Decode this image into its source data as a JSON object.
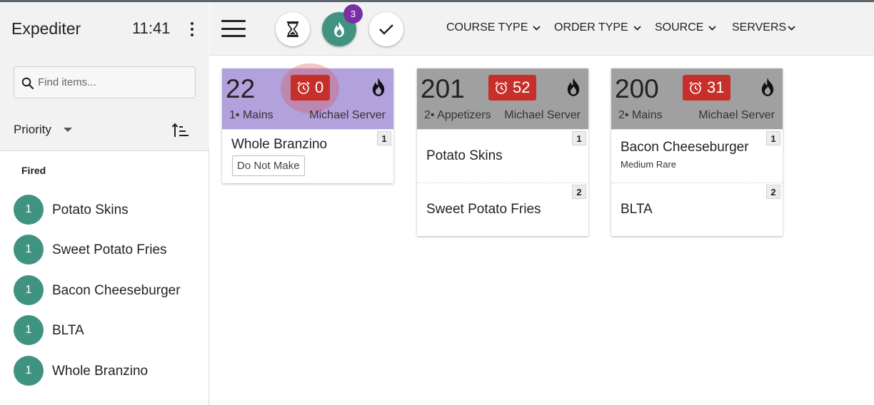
{
  "sidebar": {
    "title": "Expediter",
    "time": "11:41",
    "search_placeholder": "Find items...",
    "sort_label": "Priority",
    "section_label": "Fired",
    "fired_items": [
      {
        "count": "1",
        "name": "Potato Skins"
      },
      {
        "count": "1",
        "name": "Sweet Potato Fries"
      },
      {
        "count": "1",
        "name": "Bacon Cheeseburger"
      },
      {
        "count": "1",
        "name": "BLTA"
      },
      {
        "count": "1",
        "name": "Whole Branzino"
      }
    ]
  },
  "toolbar": {
    "fire_badge_count": "3",
    "filters": [
      "COURSE TYPE",
      "ORDER TYPE",
      "SOURCE",
      "SERVERS"
    ]
  },
  "colors": {
    "accent_teal": "#3f9380",
    "timer_red": "#c7302a",
    "badge_purple": "#7b2fa5",
    "card_head_purple": "#b3a1dd",
    "card_head_gray": "#a0a0a0"
  },
  "orders": [
    {
      "number": "22",
      "timer": "0",
      "course": "1• Mains",
      "server": "Michael Server",
      "header_color": "#b3a1dd",
      "items": [
        {
          "seat": "1",
          "name": "Whole Branzino",
          "tag": "Do Not Make"
        }
      ]
    },
    {
      "number": "201",
      "timer": "52",
      "course": "2• Appetizers",
      "server": "Michael Server",
      "header_color": "#a0a0a0",
      "items": [
        {
          "seat": "1",
          "name": "Potato Skins"
        },
        {
          "seat": "2",
          "name": "Sweet Potato Fries"
        }
      ]
    },
    {
      "number": "200",
      "timer": "31",
      "course": "2• Mains",
      "server": "Michael Server",
      "header_color": "#a0a0a0",
      "items": [
        {
          "seat": "1",
          "name": "Bacon Cheeseburger",
          "modifier": "Medium Rare"
        },
        {
          "seat": "2",
          "name": "BLTA"
        }
      ]
    }
  ]
}
